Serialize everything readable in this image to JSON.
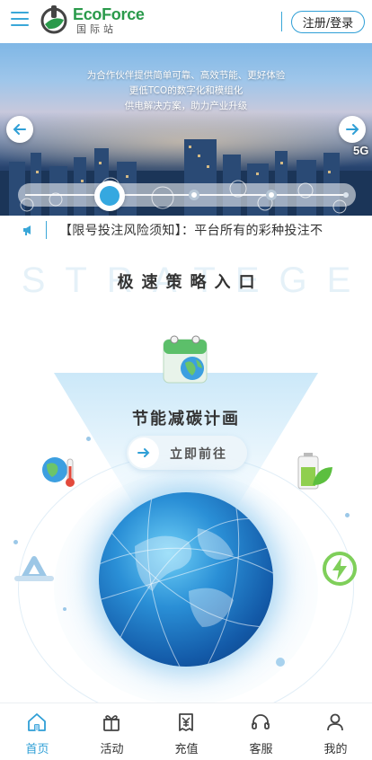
{
  "header": {
    "brand_name": "EcoForce",
    "brand_sub": "国际站",
    "login_label": "注册/登录",
    "brand_color": "#2a9a4b",
    "accent_color": "#2f9fd6"
  },
  "banner": {
    "lines": [
      "为合作伙伴提供简单可靠、高效节能、更好体验",
      "更低TCO的数字化和模组化",
      "供电解决方案，助力产业升级"
    ],
    "badge": "5G",
    "slide_position": 1,
    "slide_count": 4
  },
  "notice": {
    "text": "【限号投注风险须知】：平台所有的彩种投注不"
  },
  "section": {
    "bg_text": "STRATEGE",
    "title": "极速策略入口"
  },
  "plan": {
    "title": "节能减碳计画",
    "button_label": "立即前往"
  },
  "tabbar": {
    "items": [
      {
        "label": "首页",
        "icon": "home-icon",
        "active": true
      },
      {
        "label": "活动",
        "icon": "gift-icon",
        "active": false
      },
      {
        "label": "充值",
        "icon": "yen-receipt-icon",
        "active": false
      },
      {
        "label": "客服",
        "icon": "headset-icon",
        "active": false
      },
      {
        "label": "我的",
        "icon": "user-icon",
        "active": false
      }
    ]
  }
}
